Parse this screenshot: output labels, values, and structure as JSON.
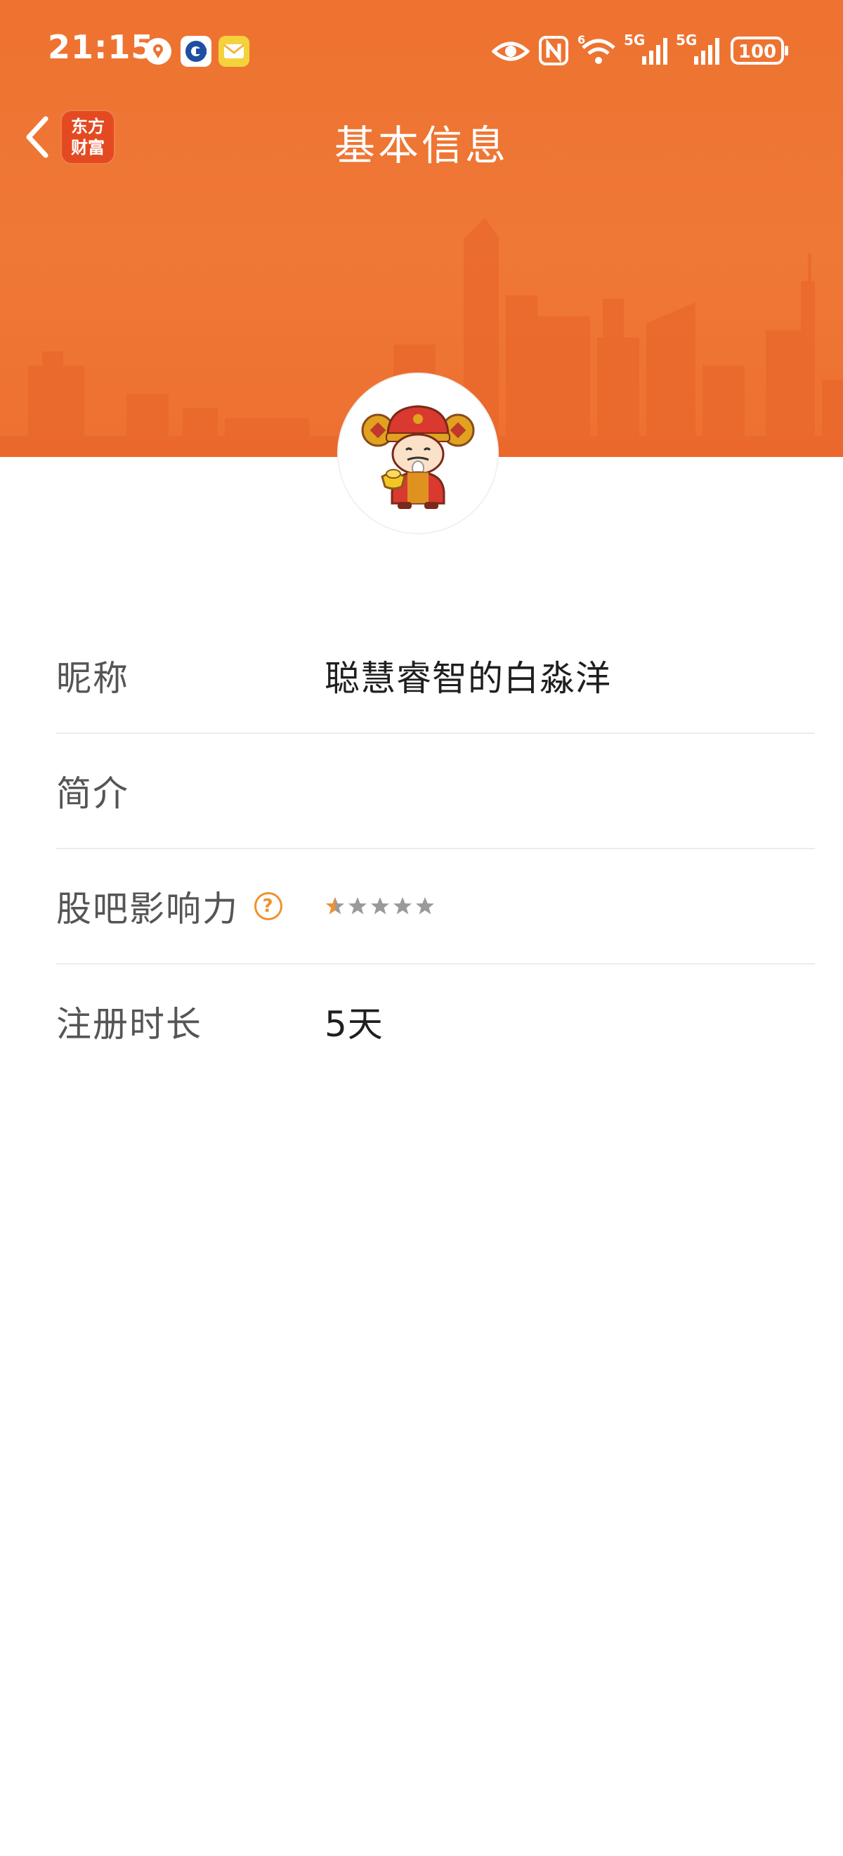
{
  "status_bar": {
    "time": "21:15",
    "battery": "100",
    "icons": [
      "location-icon",
      "china-mobile-app-icon",
      "mail-app-icon",
      "eye-icon",
      "nfc-icon",
      "wifi-icon",
      "signal-5g-icon",
      "signal-5g-icon",
      "battery-icon"
    ],
    "signal_labels": [
      "5G",
      "5G"
    ],
    "wifi_label": "6"
  },
  "nav": {
    "back_icon": "chevron-left-icon",
    "logo_line1": "东方",
    "logo_line2": "财富",
    "title": "基本信息"
  },
  "profile": {
    "avatar_icon": "god-of-wealth-avatar"
  },
  "info_rows": [
    {
      "label": "昵称",
      "value": "聪慧睿智的白淼洋"
    },
    {
      "label": "简介",
      "value": ""
    },
    {
      "label": "股吧影响力",
      "help_icon": "question-circle-icon",
      "help_text": "?",
      "rating": 0.5,
      "rating_max": 5
    },
    {
      "label": "注册时长",
      "value": "5天"
    }
  ],
  "colors": {
    "accent": "#ee7230",
    "star_filled": "#f0912f",
    "star_empty": "#9a9a9a",
    "label": "#555555",
    "value": "#1f1f1f"
  }
}
